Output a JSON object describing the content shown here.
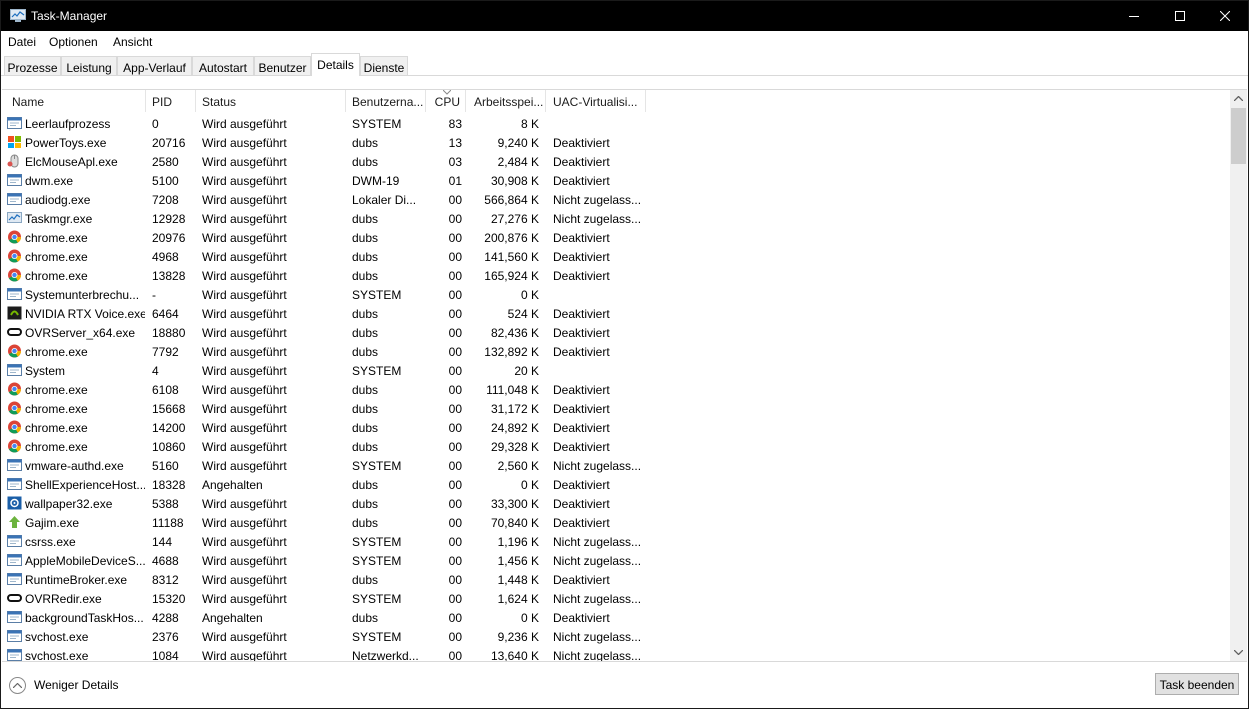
{
  "window": {
    "title": "Task-Manager"
  },
  "menu": [
    "Datei",
    "Optionen",
    "Ansicht"
  ],
  "tabs": [
    "Prozesse",
    "Leistung",
    "App-Verlauf",
    "Autostart",
    "Benutzer",
    "Details",
    "Dienste"
  ],
  "active_tab": "Details",
  "columns": [
    "Name",
    "PID",
    "Status",
    "Benutzerna...",
    "CPU",
    "Arbeitsspei...",
    "UAC-Virtualisi..."
  ],
  "sort_column": "CPU",
  "rows": [
    {
      "icon": "system-process-icon",
      "name": "Leerlaufprozess",
      "pid": "0",
      "status": "Wird ausgeführt",
      "user": "SYSTEM",
      "cpu": "83",
      "mem": "8 K",
      "uac": ""
    },
    {
      "icon": "powertoys-icon",
      "name": "PowerToys.exe",
      "pid": "20716",
      "status": "Wird ausgeführt",
      "user": "dubs",
      "cpu": "13",
      "mem": "9,240 K",
      "uac": "Deaktiviert"
    },
    {
      "icon": "mouse-icon",
      "name": "ElcMouseApl.exe",
      "pid": "2580",
      "status": "Wird ausgeführt",
      "user": "dubs",
      "cpu": "03",
      "mem": "2,484 K",
      "uac": "Deaktiviert"
    },
    {
      "icon": "system-process-icon",
      "name": "dwm.exe",
      "pid": "5100",
      "status": "Wird ausgeführt",
      "user": "DWM-19",
      "cpu": "01",
      "mem": "30,908 K",
      "uac": "Deaktiviert"
    },
    {
      "icon": "system-process-icon",
      "name": "audiodg.exe",
      "pid": "7208",
      "status": "Wird ausgeführt",
      "user": "Lokaler Di...",
      "cpu": "00",
      "mem": "566,864 K",
      "uac": "Nicht zugelass..."
    },
    {
      "icon": "taskmgr-icon",
      "name": "Taskmgr.exe",
      "pid": "12928",
      "status": "Wird ausgeführt",
      "user": "dubs",
      "cpu": "00",
      "mem": "27,276 K",
      "uac": "Nicht zugelass..."
    },
    {
      "icon": "chrome-icon",
      "name": "chrome.exe",
      "pid": "20976",
      "status": "Wird ausgeführt",
      "user": "dubs",
      "cpu": "00",
      "mem": "200,876 K",
      "uac": "Deaktiviert"
    },
    {
      "icon": "chrome-icon",
      "name": "chrome.exe",
      "pid": "4968",
      "status": "Wird ausgeführt",
      "user": "dubs",
      "cpu": "00",
      "mem": "141,560 K",
      "uac": "Deaktiviert"
    },
    {
      "icon": "chrome-icon",
      "name": "chrome.exe",
      "pid": "13828",
      "status": "Wird ausgeführt",
      "user": "dubs",
      "cpu": "00",
      "mem": "165,924 K",
      "uac": "Deaktiviert"
    },
    {
      "icon": "system-process-icon",
      "name": "Systemunterbrechu...",
      "pid": "-",
      "status": "Wird ausgeführt",
      "user": "SYSTEM",
      "cpu": "00",
      "mem": "0 K",
      "uac": ""
    },
    {
      "icon": "nvidia-icon",
      "name": "NVIDIA RTX Voice.exe",
      "pid": "6464",
      "status": "Wird ausgeführt",
      "user": "dubs",
      "cpu": "00",
      "mem": "524 K",
      "uac": "Deaktiviert"
    },
    {
      "icon": "oculus-icon",
      "name": "OVRServer_x64.exe",
      "pid": "18880",
      "status": "Wird ausgeführt",
      "user": "dubs",
      "cpu": "00",
      "mem": "82,436 K",
      "uac": "Deaktiviert"
    },
    {
      "icon": "chrome-icon",
      "name": "chrome.exe",
      "pid": "7792",
      "status": "Wird ausgeführt",
      "user": "dubs",
      "cpu": "00",
      "mem": "132,892 K",
      "uac": "Deaktiviert"
    },
    {
      "icon": "system-process-icon",
      "name": "System",
      "pid": "4",
      "status": "Wird ausgeführt",
      "user": "SYSTEM",
      "cpu": "00",
      "mem": "20 K",
      "uac": ""
    },
    {
      "icon": "chrome-icon",
      "name": "chrome.exe",
      "pid": "6108",
      "status": "Wird ausgeführt",
      "user": "dubs",
      "cpu": "00",
      "mem": "111,048 K",
      "uac": "Deaktiviert"
    },
    {
      "icon": "chrome-icon",
      "name": "chrome.exe",
      "pid": "15668",
      "status": "Wird ausgeführt",
      "user": "dubs",
      "cpu": "00",
      "mem": "31,172 K",
      "uac": "Deaktiviert"
    },
    {
      "icon": "chrome-icon",
      "name": "chrome.exe",
      "pid": "14200",
      "status": "Wird ausgeführt",
      "user": "dubs",
      "cpu": "00",
      "mem": "24,892 K",
      "uac": "Deaktiviert"
    },
    {
      "icon": "chrome-icon",
      "name": "chrome.exe",
      "pid": "10860",
      "status": "Wird ausgeführt",
      "user": "dubs",
      "cpu": "00",
      "mem": "29,328 K",
      "uac": "Deaktiviert"
    },
    {
      "icon": "system-process-icon",
      "name": "vmware-authd.exe",
      "pid": "5160",
      "status": "Wird ausgeführt",
      "user": "SYSTEM",
      "cpu": "00",
      "mem": "2,560 K",
      "uac": "Nicht zugelass..."
    },
    {
      "icon": "system-process-icon",
      "name": "ShellExperienceHost...",
      "pid": "18328",
      "status": "Angehalten",
      "user": "dubs",
      "cpu": "00",
      "mem": "0 K",
      "uac": "Deaktiviert"
    },
    {
      "icon": "wallpaper-icon",
      "name": "wallpaper32.exe",
      "pid": "5388",
      "status": "Wird ausgeführt",
      "user": "dubs",
      "cpu": "00",
      "mem": "33,300 K",
      "uac": "Deaktiviert"
    },
    {
      "icon": "gajim-icon",
      "name": "Gajim.exe",
      "pid": "11188",
      "status": "Wird ausgeführt",
      "user": "dubs",
      "cpu": "00",
      "mem": "70,840 K",
      "uac": "Deaktiviert"
    },
    {
      "icon": "system-process-icon",
      "name": "csrss.exe",
      "pid": "144",
      "status": "Wird ausgeführt",
      "user": "SYSTEM",
      "cpu": "00",
      "mem": "1,196 K",
      "uac": "Nicht zugelass..."
    },
    {
      "icon": "system-process-icon",
      "name": "AppleMobileDeviceS...",
      "pid": "4688",
      "status": "Wird ausgeführt",
      "user": "SYSTEM",
      "cpu": "00",
      "mem": "1,456 K",
      "uac": "Nicht zugelass..."
    },
    {
      "icon": "system-process-icon",
      "name": "RuntimeBroker.exe",
      "pid": "8312",
      "status": "Wird ausgeführt",
      "user": "dubs",
      "cpu": "00",
      "mem": "1,448 K",
      "uac": "Deaktiviert"
    },
    {
      "icon": "oculus-icon",
      "name": "OVRRedir.exe",
      "pid": "15320",
      "status": "Wird ausgeführt",
      "user": "SYSTEM",
      "cpu": "00",
      "mem": "1,624 K",
      "uac": "Nicht zugelass..."
    },
    {
      "icon": "system-process-icon",
      "name": "backgroundTaskHos...",
      "pid": "4288",
      "status": "Angehalten",
      "user": "dubs",
      "cpu": "00",
      "mem": "0 K",
      "uac": "Deaktiviert"
    },
    {
      "icon": "system-process-icon",
      "name": "svchost.exe",
      "pid": "2376",
      "status": "Wird ausgeführt",
      "user": "SYSTEM",
      "cpu": "00",
      "mem": "9,236 K",
      "uac": "Nicht zugelass..."
    },
    {
      "icon": "system-process-icon",
      "name": "svchost.exe",
      "pid": "1084",
      "status": "Wird ausgeführt",
      "user": "Netzwerkd...",
      "cpu": "00",
      "mem": "13,640 K",
      "uac": "Nicht zugelass..."
    }
  ],
  "footer": {
    "fewer_details": "Weniger Details",
    "end_task": "Task beenden"
  }
}
